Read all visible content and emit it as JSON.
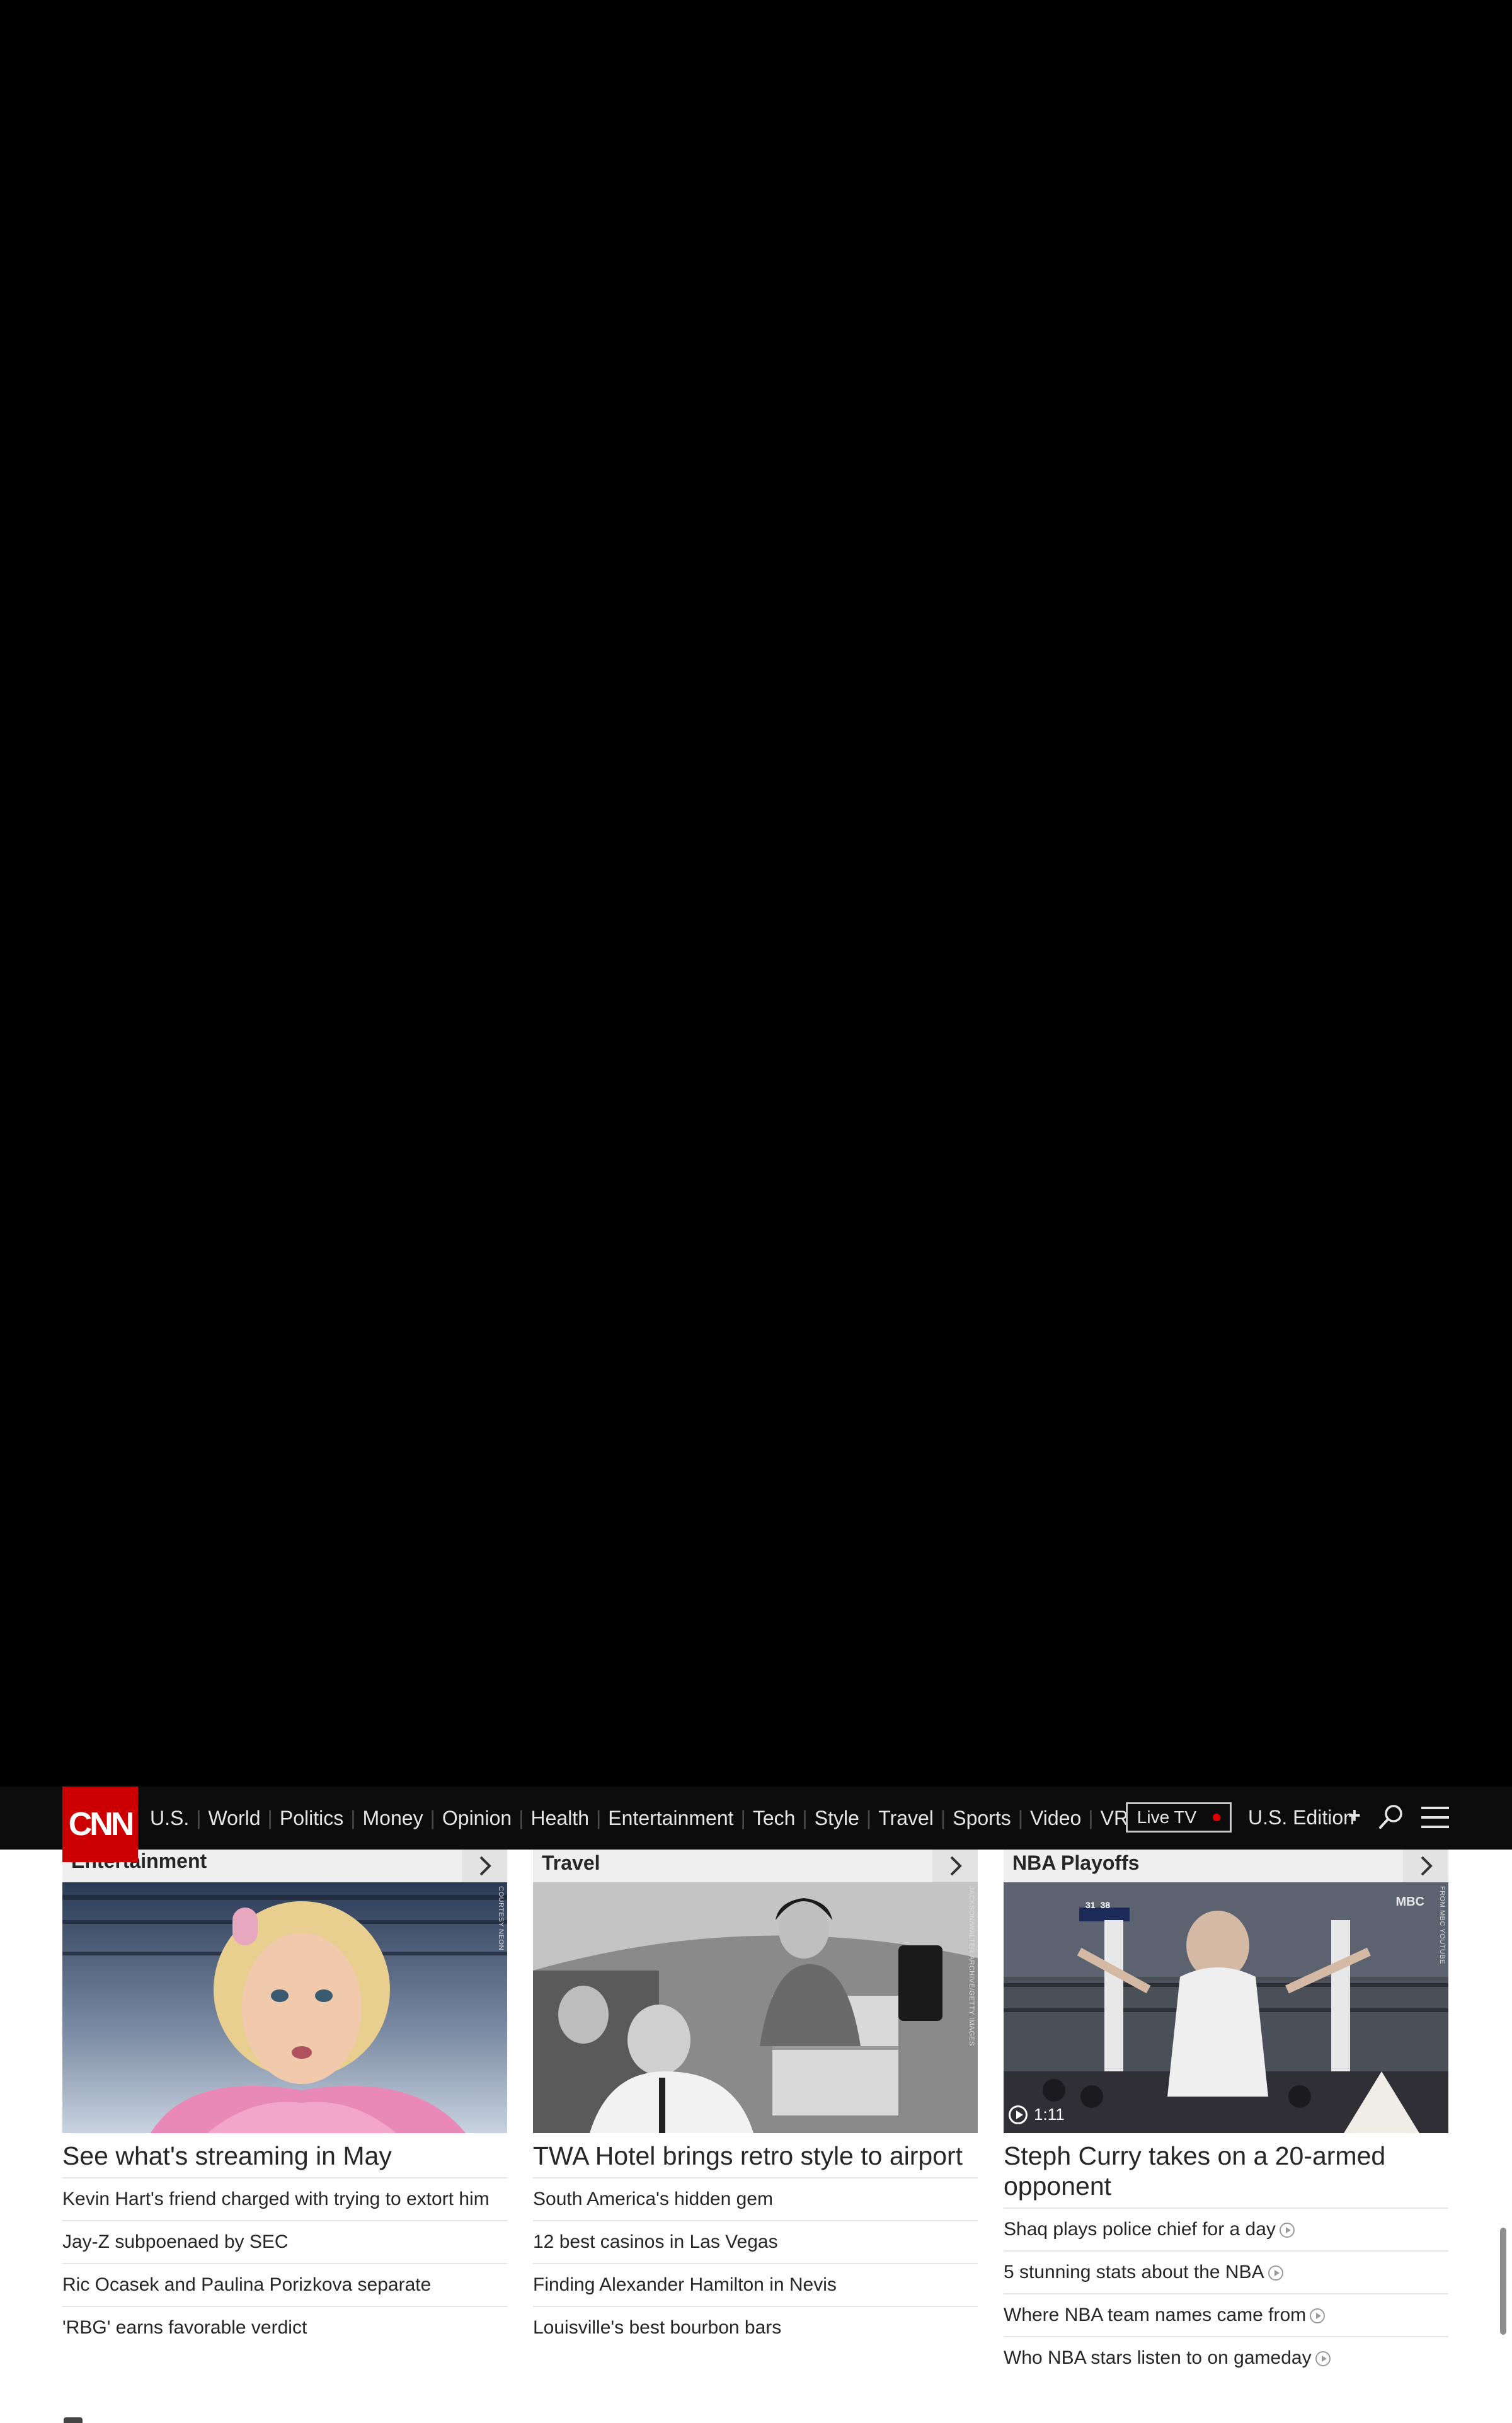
{
  "header": {
    "logo": "CNN",
    "nav": [
      "U.S.",
      "World",
      "Politics",
      "Money",
      "Opinion",
      "Health",
      "Entertainment",
      "Tech",
      "Style",
      "Travel",
      "Sports",
      "Video",
      "VR"
    ],
    "live_tv": "Live TV",
    "edition": "U.S. Edition",
    "edition_plus": "+"
  },
  "sections": [
    {
      "title": "Entertainment",
      "image_credit": "COURTESY NEON",
      "headline": "See what's streaming in May",
      "items": [
        {
          "text": "Kevin Hart's friend charged with trying to extort him"
        },
        {
          "text": "Jay-Z subpoenaed by SEC"
        },
        {
          "text": "Ric Ocasek and Paulina Porizkova separate"
        },
        {
          "text": "'RBG' earns favorable verdict"
        }
      ]
    },
    {
      "title": "Travel",
      "image_credit": "JACKSON/WALTER ARCHIVE/GETTY IMAGES",
      "headline": "TWA Hotel brings retro style to airport",
      "items": [
        {
          "text": "South America's hidden gem"
        },
        {
          "text": "12 best casinos in Las Vegas"
        },
        {
          "text": "Finding Alexander Hamilton in Nevis"
        },
        {
          "text": "Louisville's best bourbon bars"
        }
      ]
    },
    {
      "title": "NBA Playoffs",
      "image_credit": "FROM MBC YOUTUBE",
      "video_duration": "1:11",
      "headline": "Steph Curry takes on a 20-armed opponent",
      "items": [
        {
          "text": "Shaq plays police chief for a day"
        },
        {
          "text": "5 stunning stats about the NBA"
        },
        {
          "text": "Where NBA team names came from"
        },
        {
          "text": "Who NBA stars listen to on gameday"
        }
      ],
      "scoreboard": {
        "score1": "31",
        "score2": "38"
      },
      "watermark": "MBC"
    }
  ],
  "colors": {
    "brand": "#cc0000",
    "header_bg": "#0c0c0c",
    "text": "#262626"
  }
}
